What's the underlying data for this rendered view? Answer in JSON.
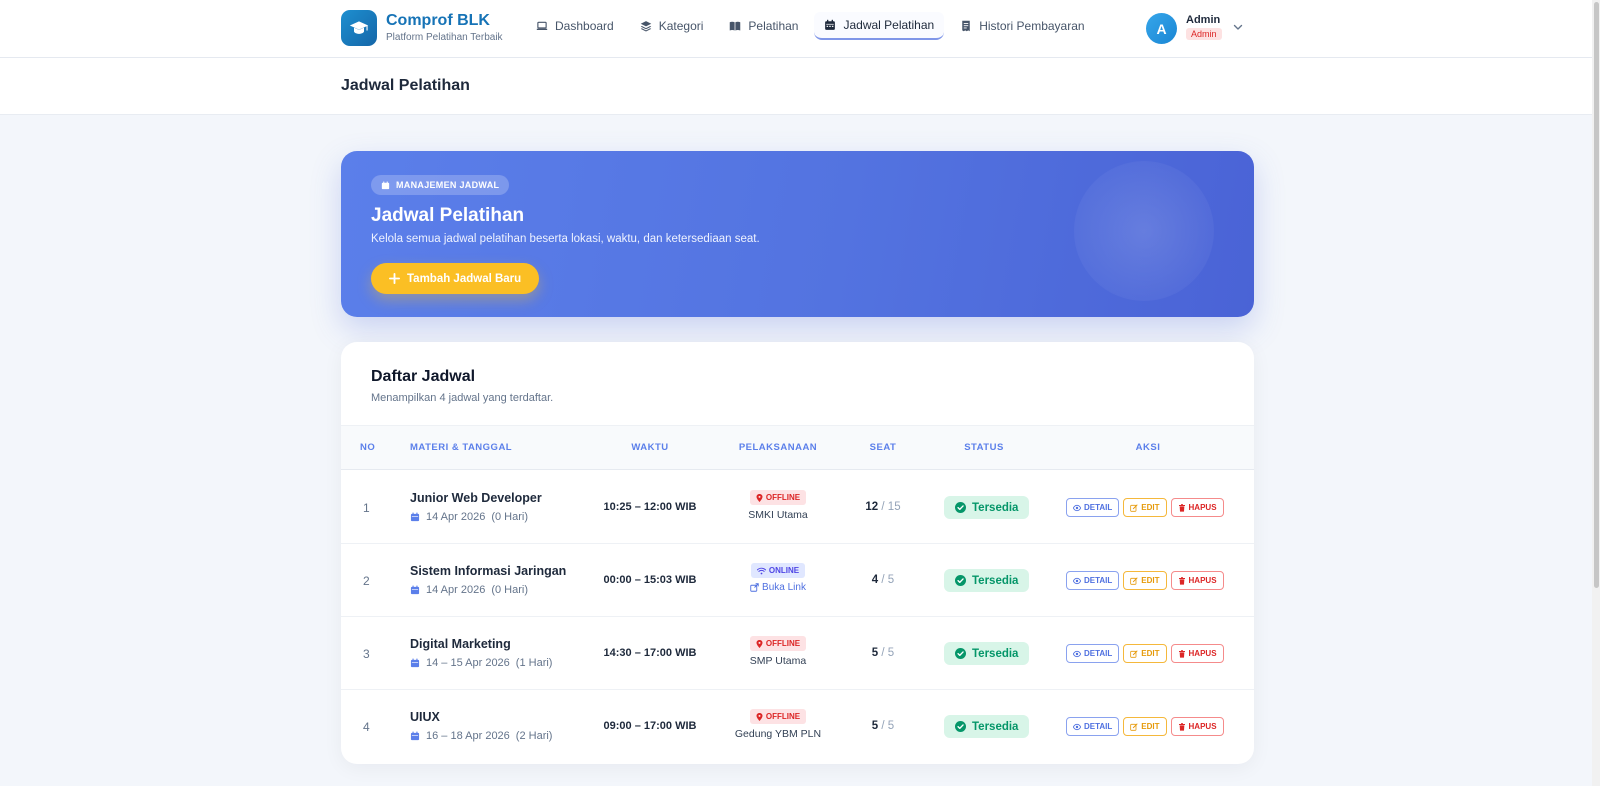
{
  "brand": {
    "name": "Comprof BLK",
    "tagline": "Platform Pelatihan Terbaik",
    "logo_icon": "graduation-cap-icon"
  },
  "nav": [
    {
      "label": "Dashboard",
      "icon": "laptop-icon",
      "active": false
    },
    {
      "label": "Kategori",
      "icon": "layers-icon",
      "active": false
    },
    {
      "label": "Pelatihan",
      "icon": "book-icon",
      "active": false
    },
    {
      "label": "Jadwal Pelatihan",
      "icon": "calendar-icon",
      "active": true
    },
    {
      "label": "Histori Pembayaran",
      "icon": "receipt-icon",
      "active": false
    }
  ],
  "user": {
    "initial": "A",
    "name": "Admin",
    "role": "Admin"
  },
  "page": {
    "title": "Jadwal Pelatihan"
  },
  "hero": {
    "badge": "MANAJEMEN JADWAL",
    "title": "Jadwal Pelatihan",
    "description": "Kelola semua jadwal pelatihan beserta lokasi, waktu, dan ketersediaan seat.",
    "button": "Tambah Jadwal Baru"
  },
  "list": {
    "title": "Daftar Jadwal",
    "subtitle": "Menampilkan 4 jadwal yang terdaftar.",
    "columns": [
      "NO",
      "MATERI & TANGGAL",
      "WAKTU",
      "PELAKSANAAN",
      "SEAT",
      "STATUS",
      "AKSI"
    ],
    "rows": [
      {
        "no": "1",
        "course": "Junior Web Developer",
        "date": "14 Apr 2026",
        "duration": "(0 Hari)",
        "time": "10:25 – 12:00 WIB",
        "mode": "OFFLINE",
        "location": "SMKI Utama",
        "seat_filled": "12",
        "seat_total": "/ 15",
        "status": "Tersedia"
      },
      {
        "no": "2",
        "course": "Sistem Informasi Jaringan",
        "date": "14 Apr 2026",
        "duration": "(0 Hari)",
        "time": "00:00 – 15:03 WIB",
        "mode": "ONLINE",
        "location": "Buka Link",
        "seat_filled": "4",
        "seat_total": "/ 5",
        "status": "Tersedia"
      },
      {
        "no": "3",
        "course": "Digital Marketing",
        "date": "14 – 15 Apr 2026",
        "duration": "(1 Hari)",
        "time": "14:30 – 17:00 WIB",
        "mode": "OFFLINE",
        "location": "SMP Utama",
        "seat_filled": "5",
        "seat_total": "/ 5",
        "status": "Tersedia"
      },
      {
        "no": "4",
        "course": "UIUX",
        "date": "16 – 18 Apr 2026",
        "duration": "(2 Hari)",
        "time": "09:00 – 17:00 WIB",
        "mode": "OFFLINE",
        "location": "Gedung YBM PLN",
        "seat_filled": "5",
        "seat_total": "/ 5",
        "status": "Tersedia"
      }
    ],
    "actions": {
      "detail": "DETAIL",
      "edit": "EDIT",
      "hapus": "HAPUS"
    }
  },
  "colors": {
    "primary": "#5b7fea",
    "accent": "#fbbf24",
    "success": "#059669",
    "danger": "#dc2626",
    "brand": "#1673b6"
  }
}
